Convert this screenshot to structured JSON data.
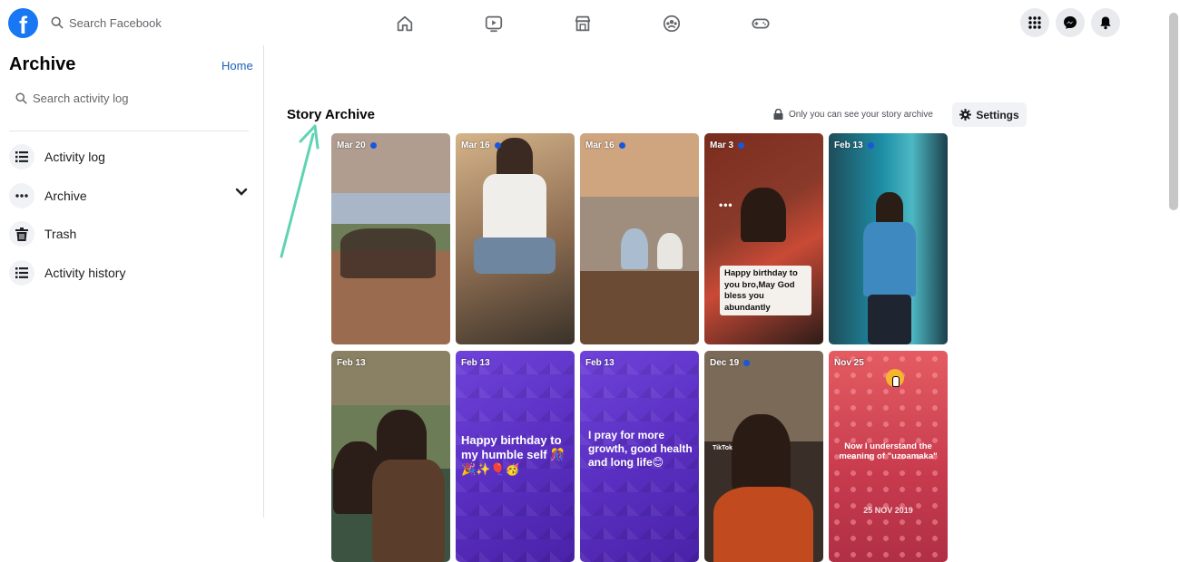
{
  "topbar": {
    "logo": "f",
    "search_placeholder": "Search Facebook",
    "nav": [
      "home-icon",
      "watch-icon",
      "marketplace-icon",
      "groups-icon",
      "gaming-icon"
    ],
    "right": [
      "menu-grid-icon",
      "messenger-icon",
      "bell-icon"
    ]
  },
  "sidebar": {
    "title": "Archive",
    "home_link": "Home",
    "search_placeholder": "Search activity log",
    "items": [
      {
        "label": "Activity log",
        "icon": "list-icon"
      },
      {
        "label": "Archive",
        "icon": "more-dots-icon"
      },
      {
        "label": "Trash",
        "icon": "trash-icon"
      },
      {
        "label": "Activity history",
        "icon": "list-icon"
      }
    ]
  },
  "main": {
    "title": "Story Archive",
    "privacy_note": "Only you can see your story archive",
    "settings_label": "Settings",
    "stories": [
      {
        "date": "Mar 20",
        "dot": true
      },
      {
        "date": "Mar 16",
        "dot": true
      },
      {
        "date": "Mar 16",
        "dot": true
      },
      {
        "date": "Mar 3",
        "dot": true,
        "caption": "Happy birthday to you bro,May God bless you abundantly"
      },
      {
        "date": "Feb 13",
        "dot": true
      },
      {
        "date": "Feb 13",
        "dot": false
      },
      {
        "date": "Feb 13",
        "dot": false,
        "caption": "Happy birthday to my humble self 🎊🎉✨🎈🥳"
      },
      {
        "date": "Feb 13",
        "dot": false,
        "caption": "I pray for more growth, good health and long life😊"
      },
      {
        "date": "Dec 19",
        "dot": true,
        "watermark": "TikTok"
      },
      {
        "date": "Nov 25",
        "dot": false,
        "caption": "Now I understand the meaning of \"uzoamaka\"",
        "footer": "25 NOV 2019"
      }
    ]
  },
  "colors": {
    "brand": "#1877f2",
    "arrow": "#5fd3b3"
  }
}
